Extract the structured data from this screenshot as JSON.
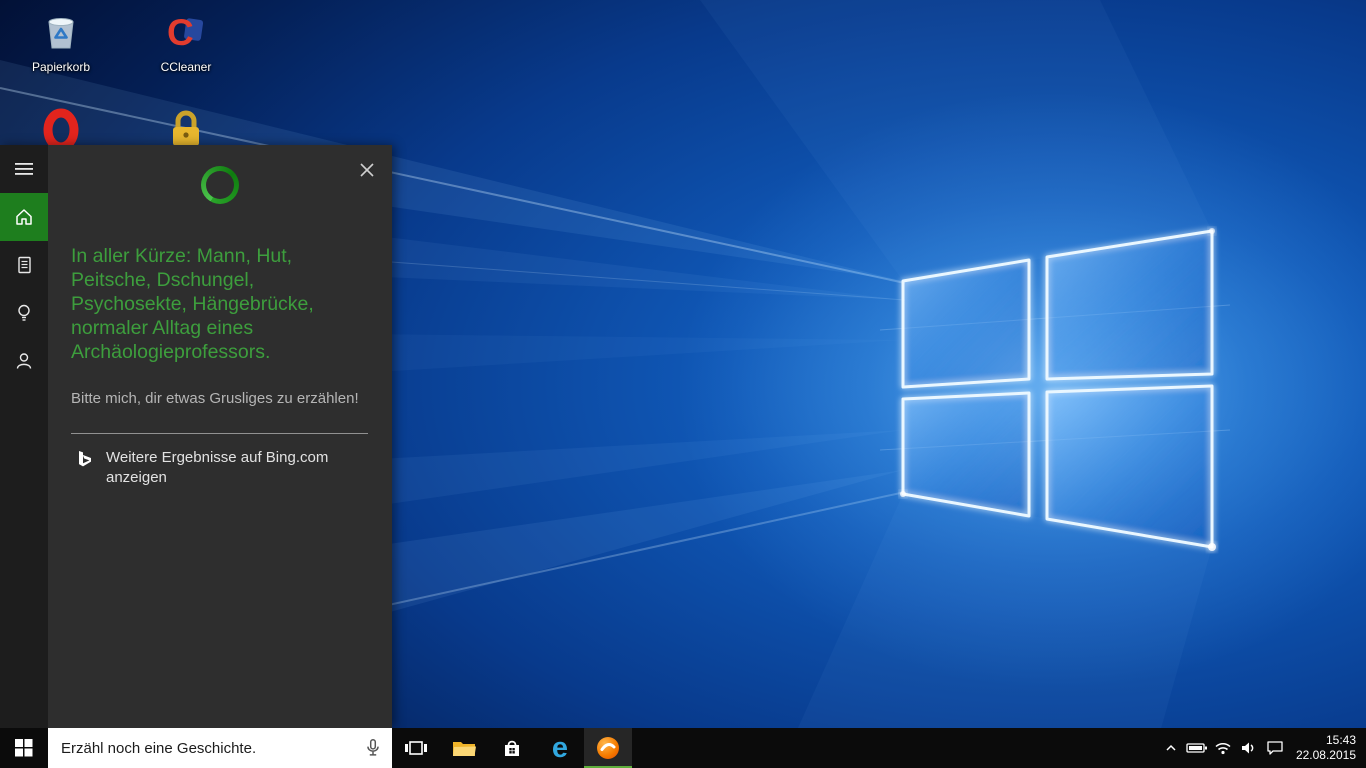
{
  "desktop": {
    "icons": [
      {
        "name": "recycle-bin",
        "label": "Papierkorb"
      },
      {
        "name": "ccleaner",
        "label": "CCleaner"
      },
      {
        "name": "opera"
      },
      {
        "name": "security-lock"
      }
    ]
  },
  "cortana": {
    "rail": [
      {
        "name": "menu"
      },
      {
        "name": "home",
        "active": true
      },
      {
        "name": "notebook"
      },
      {
        "name": "reminders"
      },
      {
        "name": "feedback"
      }
    ],
    "headline": "In aller Kürze: Mann, Hut, Peitsche, Dschungel, Psychosekte, Hängebrücke, normaler Alltag eines Archäologieprofessors.",
    "prompt": "Bitte mich, dir etwas Grusliges zu erzählen!",
    "bing_link": "Weitere Ergebnisse auf Bing.com anzeigen"
  },
  "taskbar": {
    "search_value": "Erzähl noch eine Geschichte.",
    "apps": [
      {
        "name": "task-view"
      },
      {
        "name": "file-explorer"
      },
      {
        "name": "store"
      },
      {
        "name": "edge"
      },
      {
        "name": "avast",
        "active": true
      }
    ],
    "tray_icons": [
      "hidden-icons-chevron",
      "battery",
      "wifi",
      "volume",
      "action-center"
    ],
    "clock": {
      "time": "15:43",
      "date": "22.08.2015"
    }
  },
  "colors": {
    "cortana_green_text": "#3d9e3d",
    "cortana_home_tile": "#1e7e1e",
    "panel_bg": "#2e2e2e",
    "rail_bg": "#1d1d1d",
    "taskbar_bg": "#0b0b0b",
    "avast_orange": "#ef6c00",
    "edge_blue": "#31a8e0"
  }
}
